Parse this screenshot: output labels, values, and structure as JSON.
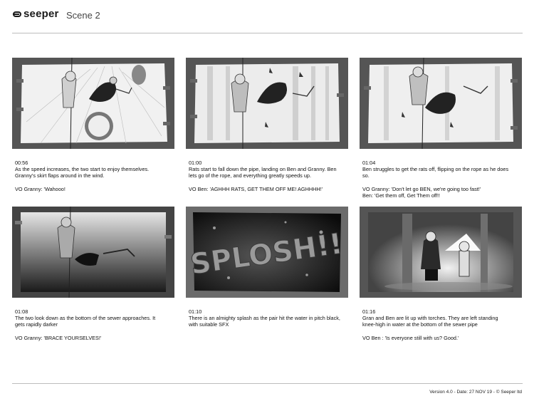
{
  "header": {
    "logo": "seeper",
    "scene": "Scene 2"
  },
  "panels": [
    {
      "time": "00:56",
      "desc": [
        "As the speed increases, the two start to enjoy themselves.",
        "Granny's skirt flaps around in the wind."
      ],
      "vo": [
        "VO Granny: 'Wahooo!"
      ]
    },
    {
      "time": "01:00",
      "desc": [
        "Rats start to fall down the pipe, landing on Ben and Granny. Ben",
        "lets go of the rope, and everything greatly speeds up."
      ],
      "vo": [
        "VO Ben: 'AGHHH RATS, GET THEM OFF ME! AGHHHH!'"
      ]
    },
    {
      "time": "01:04",
      "desc": [
        "Ben struggles to get the rats off, flipping on the rope as he does",
        "so."
      ],
      "vo": [
        "VO Granny: 'Don't let go BEN, we're going too fast!'",
        "Ben: 'Get them off, Get Them off!!"
      ]
    },
    {
      "time": "01:08",
      "desc": [
        "The two look down as the bottom of the sewer approaches. It",
        "gets rapidly darker"
      ],
      "vo": [
        "VO Granny: 'BRACE YOURSELVES!'"
      ]
    },
    {
      "time": "01:10",
      "desc": [
        "There is an almighty splash as the pair hit the water in pitch black,",
        "with suitable SFX"
      ],
      "vo": [],
      "sfx": "SPLOSH!!"
    },
    {
      "time": "01:16",
      "desc": [
        "Gran and Ben are lit up with torches. They are left standing",
        "knee-high in water at the bottom of the sewer pipe"
      ],
      "vo": [
        "VO Ben : 'Is everyone still with us? Good.'"
      ]
    }
  ],
  "footer": "Version 4.0 - Date: 27 NOV 19 - © Seeper ltd"
}
